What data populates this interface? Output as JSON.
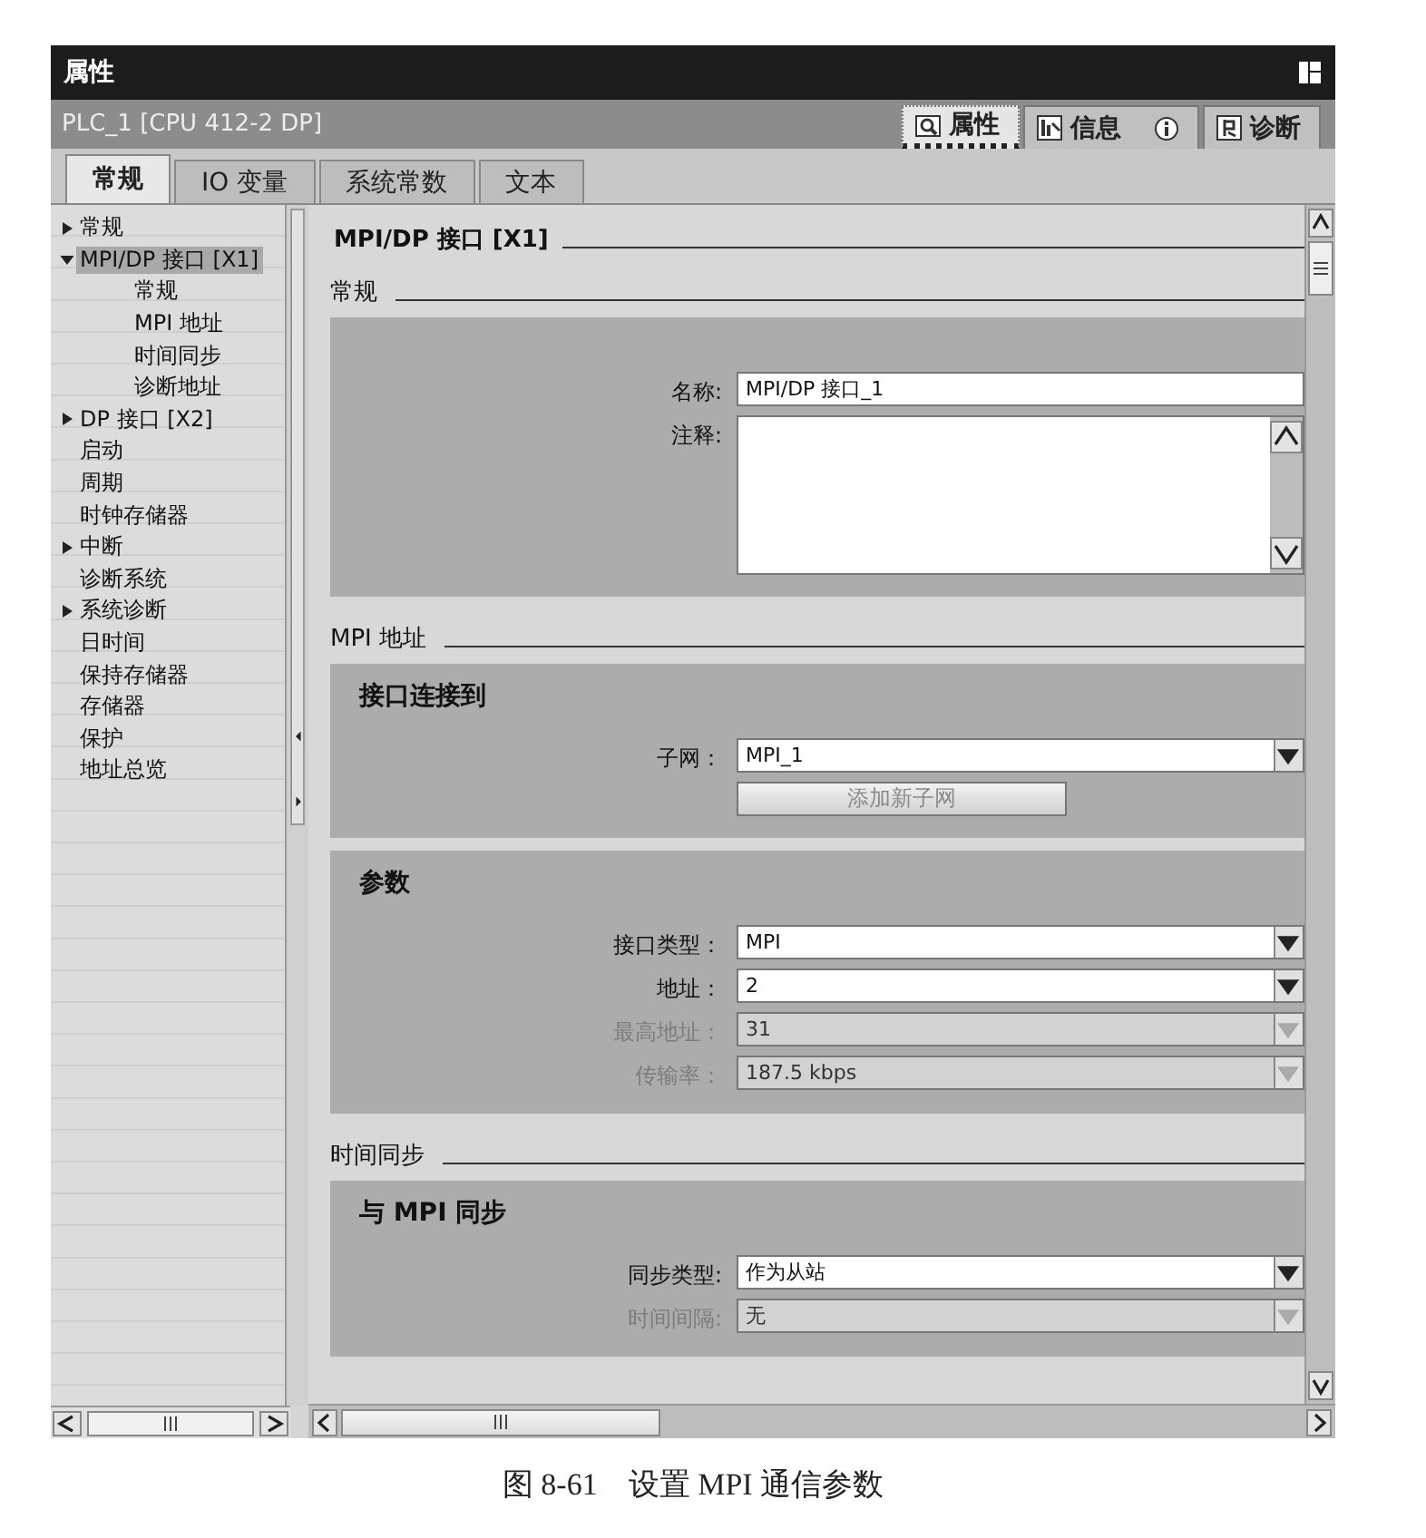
{
  "panel": {
    "title": "属性"
  },
  "object_name": "PLC_1 [CPU  412-2 DP]",
  "inspector_tabs": [
    {
      "label": "属性",
      "selected": true,
      "kind": "properties"
    },
    {
      "label": "信息",
      "selected": false,
      "kind": "info"
    },
    {
      "label": "诊断",
      "selected": false,
      "kind": "diagnostics"
    }
  ],
  "tabs": [
    {
      "label": "常规",
      "selected": true
    },
    {
      "label": "IO 变量",
      "selected": false
    },
    {
      "label": "系统常数",
      "selected": false
    },
    {
      "label": "文本",
      "selected": false
    }
  ],
  "nav": {
    "items": [
      {
        "label": "常规",
        "kind": "group",
        "expanded": false,
        "selected": false
      },
      {
        "label": "MPI/DP 接口 [X1]",
        "kind": "group",
        "expanded": true,
        "selected": true,
        "children": [
          {
            "label": "常规",
            "kind": "leaf",
            "selected": false
          },
          {
            "label": "MPI 地址",
            "kind": "leaf",
            "selected": false
          },
          {
            "label": "时间同步",
            "kind": "leaf",
            "selected": false
          },
          {
            "label": "诊断地址",
            "kind": "leaf",
            "selected": false
          }
        ]
      },
      {
        "label": "DP 接口 [X2]",
        "kind": "group",
        "expanded": false,
        "selected": false
      },
      {
        "label": "启动",
        "kind": "leaf",
        "selected": false
      },
      {
        "label": "周期",
        "kind": "leaf",
        "selected": false
      },
      {
        "label": "时钟存储器",
        "kind": "leaf",
        "selected": false
      },
      {
        "label": "中断",
        "kind": "group",
        "expanded": false,
        "selected": false
      },
      {
        "label": "诊断系统",
        "kind": "leaf",
        "selected": false
      },
      {
        "label": "系统诊断",
        "kind": "group",
        "expanded": false,
        "selected": false
      },
      {
        "label": "日时间",
        "kind": "leaf",
        "selected": false
      },
      {
        "label": "保持存储器",
        "kind": "leaf",
        "selected": false
      },
      {
        "label": "存储器",
        "kind": "leaf",
        "selected": false
      },
      {
        "label": "保护",
        "kind": "leaf",
        "selected": false
      },
      {
        "label": "地址总览",
        "kind": "leaf",
        "selected": false
      }
    ]
  },
  "content": {
    "heading": "MPI/DP 接口 [X1]",
    "sections": [
      {
        "title": "常规",
        "groups": [
          {
            "fields": [
              {
                "kind": "text",
                "label": "名称:",
                "value": "MPI/DP 接口_1",
                "disabled": false
              },
              {
                "kind": "textarea",
                "label": "注释:",
                "disabled": false
              }
            ]
          }
        ]
      },
      {
        "title": "MPI 地址",
        "groups": [
          {
            "title": "接口连接到",
            "fields": [
              {
                "kind": "dropdown",
                "label": "子网：",
                "value": "MPI_1",
                "disabled": false
              },
              {
                "kind": "button",
                "label": "添加新子网",
                "disabled": true
              }
            ]
          },
          {
            "title": "参数",
            "fields": [
              {
                "kind": "dropdown",
                "label": "接口类型：",
                "value": "MPI",
                "disabled": false
              },
              {
                "kind": "dropdown",
                "label": "地址：",
                "value": "2",
                "disabled": false
              },
              {
                "kind": "dropdown",
                "label": "最高地址：",
                "value": "31",
                "disabled": true
              },
              {
                "kind": "dropdown",
                "label": "传输率：",
                "value": "187.5 kbps",
                "disabled": true
              }
            ]
          }
        ]
      },
      {
        "title": "时间同步",
        "groups": [
          {
            "title": "与 MPI 同步",
            "fields": [
              {
                "kind": "dropdown",
                "label": "同步类型:",
                "value": "作为从站",
                "disabled": false
              },
              {
                "kind": "dropdown",
                "label": "时间间隔:",
                "value": "无",
                "disabled": true
              }
            ]
          }
        ]
      }
    ]
  },
  "caption": "图 8-61　设置 MPI 通信参数"
}
